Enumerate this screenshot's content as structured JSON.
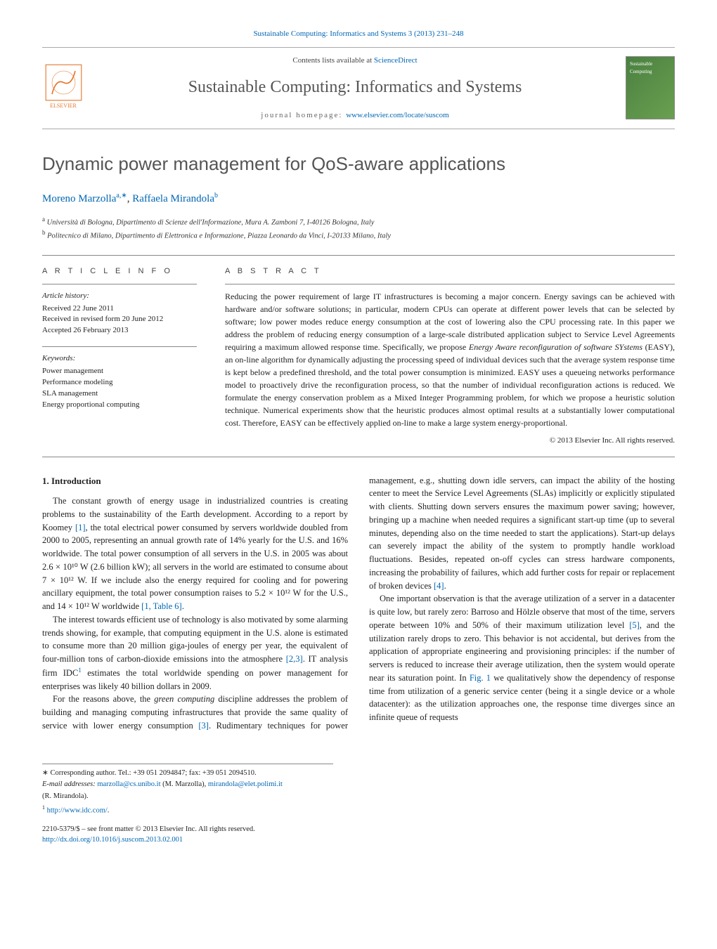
{
  "top_link": "Sustainable Computing: Informatics and Systems 3 (2013) 231–248",
  "header": {
    "contents_prefix": "Contents lists available at ",
    "contents_link": "ScienceDirect",
    "journal_name": "Sustainable Computing: Informatics and Systems",
    "homepage_prefix": "journal homepage: ",
    "homepage_link": "www.elsevier.com/locate/suscom",
    "publisher_label": "ELSEVIER",
    "cover_label": "Sustainable Computing"
  },
  "title": "Dynamic power management for QoS-aware applications",
  "authors": {
    "a1_name": "Moreno Marzolla",
    "a1_sup": "a,∗",
    "a2_name": "Raffaela Mirandola",
    "a2_sup": "b"
  },
  "affiliations": {
    "a_sup": "a",
    "a_text": "Università di Bologna, Dipartimento di Scienze dell'Informazione, Mura A. Zamboni 7, I-40126 Bologna, Italy",
    "b_sup": "b",
    "b_text": "Politecnico di Milano, Dipartimento di Elettronica e Informazione, Piazza Leonardo da Vinci, I-20133 Milano, Italy"
  },
  "article_info": {
    "head": "A R T I C L E   I N F O",
    "history_head": "Article history:",
    "history_lines": [
      "Received 22 June 2011",
      "Received in revised form 20 June 2012",
      "Accepted 26 February 2013"
    ],
    "keywords_head": "Keywords:",
    "keywords": [
      "Power management",
      "Performance modeling",
      "SLA management",
      "Energy proportional computing"
    ]
  },
  "abstract": {
    "head": "A B S T R A C T",
    "text_before_em": "Reducing the power requirement of large IT infrastructures is becoming a major concern. Energy savings can be achieved with hardware and/or software solutions; in particular, modern CPUs can operate at different power levels that can be selected by software; low power modes reduce energy consumption at the cost of lowering also the CPU processing rate. In this paper we address the problem of reducing energy consumption of a large-scale distributed application subject to Service Level Agreements requiring a maximum allowed response time. Specifically, we propose ",
    "em_text": "Energy Aware reconfiguration of software SYstems",
    "text_after_em": " (EASY), an on-line algorithm for dynamically adjusting the processing speed of individual devices such that the average system response time is kept below a predefined threshold, and the total power consumption is minimized. EASY uses a queueing networks performance model to proactively drive the reconfiguration process, so that the number of individual reconfiguration actions is reduced. We formulate the energy conservation problem as a Mixed Integer Programming problem, for which we propose a heuristic solution technique. Numerical experiments show that the heuristic produces almost optimal results at a substantially lower computational cost. Therefore, EASY can be effectively applied on-line to make a large system energy-proportional.",
    "copyright": "© 2013 Elsevier Inc. All rights reserved."
  },
  "body": {
    "section_head": "1. Introduction",
    "p1_a": "The constant growth of energy usage in industrialized countries is creating problems to the sustainability of the Earth development. According to a report by Koomey ",
    "p1_cite1": "[1]",
    "p1_b": ", the total electrical power consumed by servers worldwide doubled from 2000 to 2005, representing an annual growth rate of 14% yearly for the U.S. and 16% worldwide. The total power consumption of all servers in the U.S. in 2005 was about 2.6 × 10¹⁰ W (2.6 billion kW); all servers in the world are estimated to consume about 7 × 10¹² W. If we include also the energy required for cooling and for powering ancillary equipment, the total power consumption raises to 5.2 × 10¹² W for the U.S., and 14 × 10¹² W worldwide ",
    "p1_cite2": "[1, Table 6]",
    "p1_c": ".",
    "p2_a": "The interest towards efficient use of technology is also motivated by some alarming trends showing, for example, that computing equipment in the U.S. alone is estimated to consume more than 20 million giga-joules of energy per year, the equivalent of four-million tons of carbon-dioxide emissions into the atmosphere ",
    "p2_cite1": "[2,3]",
    "p2_b": ". IT analysis firm IDC",
    "p2_fn": "1",
    "p2_c": " estimates the total worldwide spending on power management for enterprises was likely 40 billion dollars in 2009.",
    "p3_a": "For the reasons above, the ",
    "p3_em": "green computing",
    "p3_b": " discipline addresses the problem of building and managing computing infrastructures that provide the same quality of service with lower energy consumption ",
    "p3_cite1": "[3]",
    "p3_c": ". Rudimentary techniques for power management, e.g., shutting down idle servers, can impact the ability of the hosting center to meet the Service Level Agreements (SLAs) implicitly or explicitly stipulated with clients. Shutting down servers ensures the maximum power saving; however, bringing up a machine when needed requires a significant start-up time (up to several minutes, depending also on the time needed to start the applications). Start-up delays can severely impact the ability of the system to promptly handle workload fluctuations. Besides, repeated on-off cycles can stress hardware components, increasing the probability of failures, which add further costs for repair or replacement of broken devices ",
    "p3_cite2": "[4]",
    "p3_d": ".",
    "p4_a": "One important observation is that the average utilization of a server in a datacenter is quite low, but rarely zero: Barroso and Hölzle observe that most of the time, servers operate between 10% and 50% of their maximum utilization level ",
    "p4_cite1": "[5]",
    "p4_b": ", and the utilization rarely drops to zero. This behavior is not accidental, but derives from the application of appropriate engineering and provisioning principles: if the number of servers is reduced to increase their average utilization, then the system would operate near its saturation point. In ",
    "p4_cite2": "Fig. 1",
    "p4_c": " we qualitatively show the dependency of response time from utilization of a generic service center (being it a single device or a whole datacenter): as the utilization approaches one, the response time diverges since an infinite queue of requests"
  },
  "footnotes": {
    "corr_label": "∗",
    "corr_text": "Corresponding author. Tel.: +39 051 2094847; fax: +39 051 2094510.",
    "email_label": "E-mail addresses: ",
    "email1": "marzolla@cs.unibo.it",
    "email1_who": " (M. Marzolla), ",
    "email2": "mirandola@elet.polimi.it",
    "email2_who": " (R. Mirandola).",
    "fn1_sup": "1",
    "fn1_link": "http://www.idc.com/",
    "fn1_tail": "."
  },
  "bottom": {
    "issn_line": "2210-5379/$ – see front matter © 2013 Elsevier Inc. All rights reserved.",
    "doi": "http://dx.doi.org/10.1016/j.suscom.2013.02.001"
  }
}
